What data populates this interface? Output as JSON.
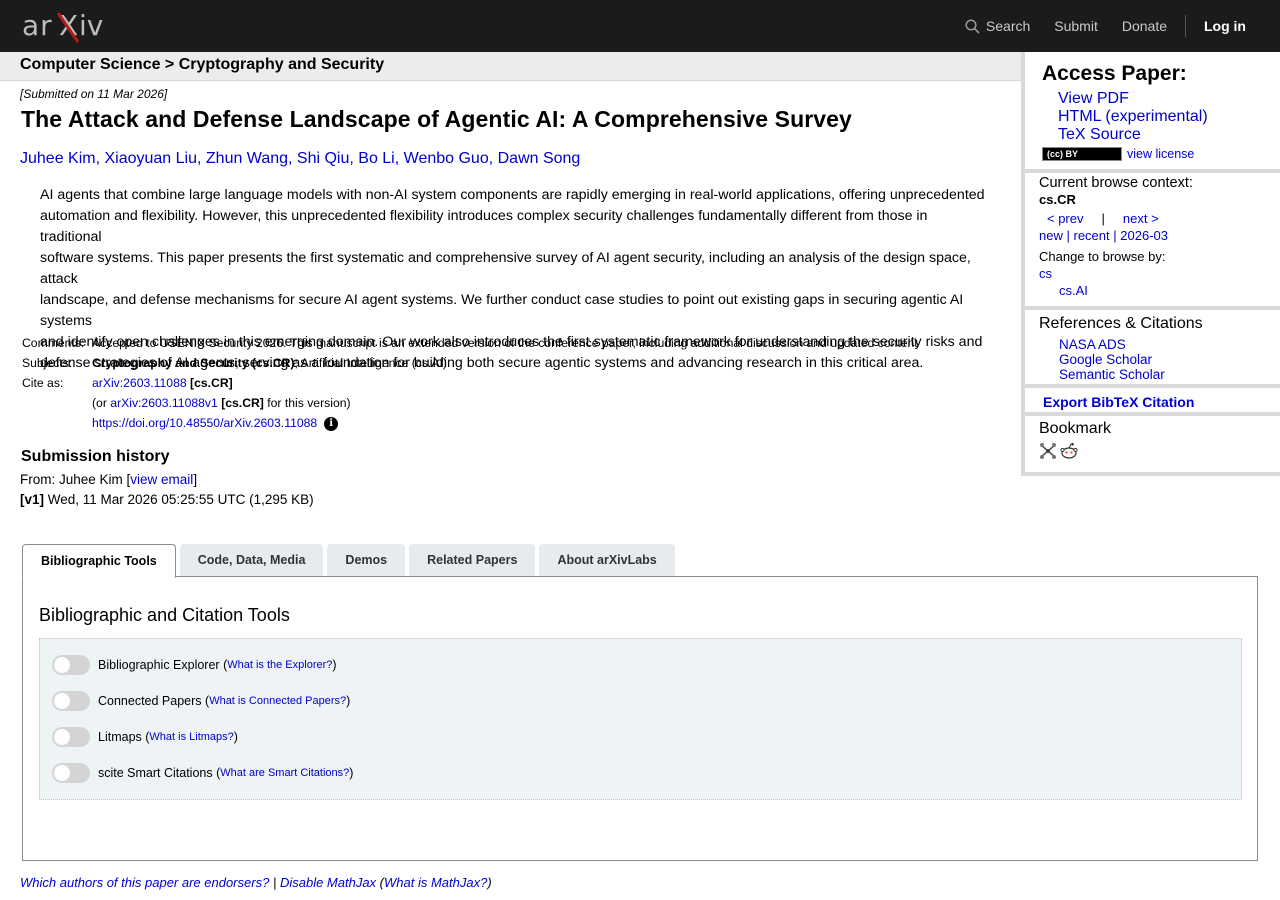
{
  "brand": {
    "logo_text": "arXiv"
  },
  "nav": {
    "search": "Search",
    "submit": "Submit",
    "donate": "Donate",
    "login": "Log in"
  },
  "breadcrumb": "Computer Science > Cryptography and Security",
  "paper": {
    "submitted": "[Submitted on 11 Mar 2026]",
    "title": "The Attack and Defense Landscape of Agentic AI: A Comprehensive Survey",
    "authors": [
      "Juhee Kim",
      "Xiaoyuan Liu",
      "Zhun Wang",
      "Shi Qiu",
      "Bo Li",
      "Wenbo Guo",
      "Dawn Song"
    ],
    "abstract_lines": [
      "AI agents that combine large language models with non-AI system components are rapidly emerging in real-world applications, offering unprecedented",
      "automation and flexibility. However, this unprecedented flexibility introduces complex security challenges fundamentally different from those in traditional",
      "software systems. This paper presents the first systematic and comprehensive survey of AI agent security, including an analysis of the design space, attack",
      "landscape, and defense mechanisms for secure AI agent systems. We further conduct case studies to point out existing gaps in securing agentic AI systems",
      "and identify open challenges in this emerging domain. Our work also introduces the first systematic framework for understanding the security risks and",
      "defense strategies of AI agents, serving as a foundation for building both secure agentic systems and advancing research in this critical area."
    ]
  },
  "meta": {
    "comments_label": "Comments:",
    "comments": "Accepted to USENIX Security 2026. This manuscript is an extended version of the conference paper, including additional discussion and updated content",
    "subjects_label": "Subjects:",
    "subjects_primary": "Cryptography and Security (cs.CR)",
    "subjects_rest": "; Artificial Intelligence (cs.AI)",
    "cite_label": "Cite as:",
    "cite_id": "arXiv:2603.11088",
    "cite_cat": "[cs.CR]",
    "cite_or_pre": "(or ",
    "cite_version": "arXiv:2603.11088v1",
    "cite_or_post": "for this version)",
    "doi": "https://doi.org/10.48550/arXiv.2603.11088",
    "doi_icon": "i"
  },
  "submission": {
    "heading": "Submission history",
    "from_prefix": "From: Juhee Kim [",
    "view_email": "view email",
    "from_suffix": "]",
    "v1_tag": "[v1]",
    "v1_detail": " Wed, 11 Mar 2026 05:25:55 UTC (1,295 KB)"
  },
  "sidebar": {
    "access_title": "Access Paper:",
    "view_pdf": "View PDF",
    "html": "HTML (experimental)",
    "tex": "TeX Source",
    "cc_badge": "(cc) BY",
    "view_license": "view license",
    "context_title": "Current browse context:",
    "context_cat": "cs.CR",
    "prev": "< prev",
    "pipe": "|",
    "next": "next >",
    "new": "new",
    "recent": "recent",
    "month": "2026-03",
    "change_browse": "Change to browse by:",
    "browse_cs": "cs",
    "browse_csai": "cs.AI",
    "refs_title": "References & Citations",
    "nasa": "NASA ADS",
    "google": "Google Scholar",
    "semantic": "Semantic Scholar",
    "export": "Export BibTeX Citation",
    "bookmark_title": "Bookmark"
  },
  "tabs": [
    "Bibliographic Tools",
    "Code, Data, Media",
    "Demos",
    "Related Papers",
    "About arXivLabs"
  ],
  "tools_heading": "Bibliographic and Citation Tools",
  "tools": [
    {
      "label": "Bibliographic Explorer",
      "link": "What is the Explorer?"
    },
    {
      "label": "Connected Papers",
      "link": "What is Connected Papers?"
    },
    {
      "label": "Litmaps",
      "link": "What is Litmaps?"
    },
    {
      "label": "scite Smart Citations",
      "link": "What are Smart Citations?"
    }
  ],
  "footer": {
    "endorsers": "Which authors of this paper are endorsers?",
    "pipe": "|",
    "disable_mathjax": "Disable MathJax",
    "what_mathjax": "What is MathJax?"
  },
  "colors": {
    "topbar": "#1b1b1b",
    "link": "#0000cc",
    "logo_x": "#b31b1b"
  }
}
